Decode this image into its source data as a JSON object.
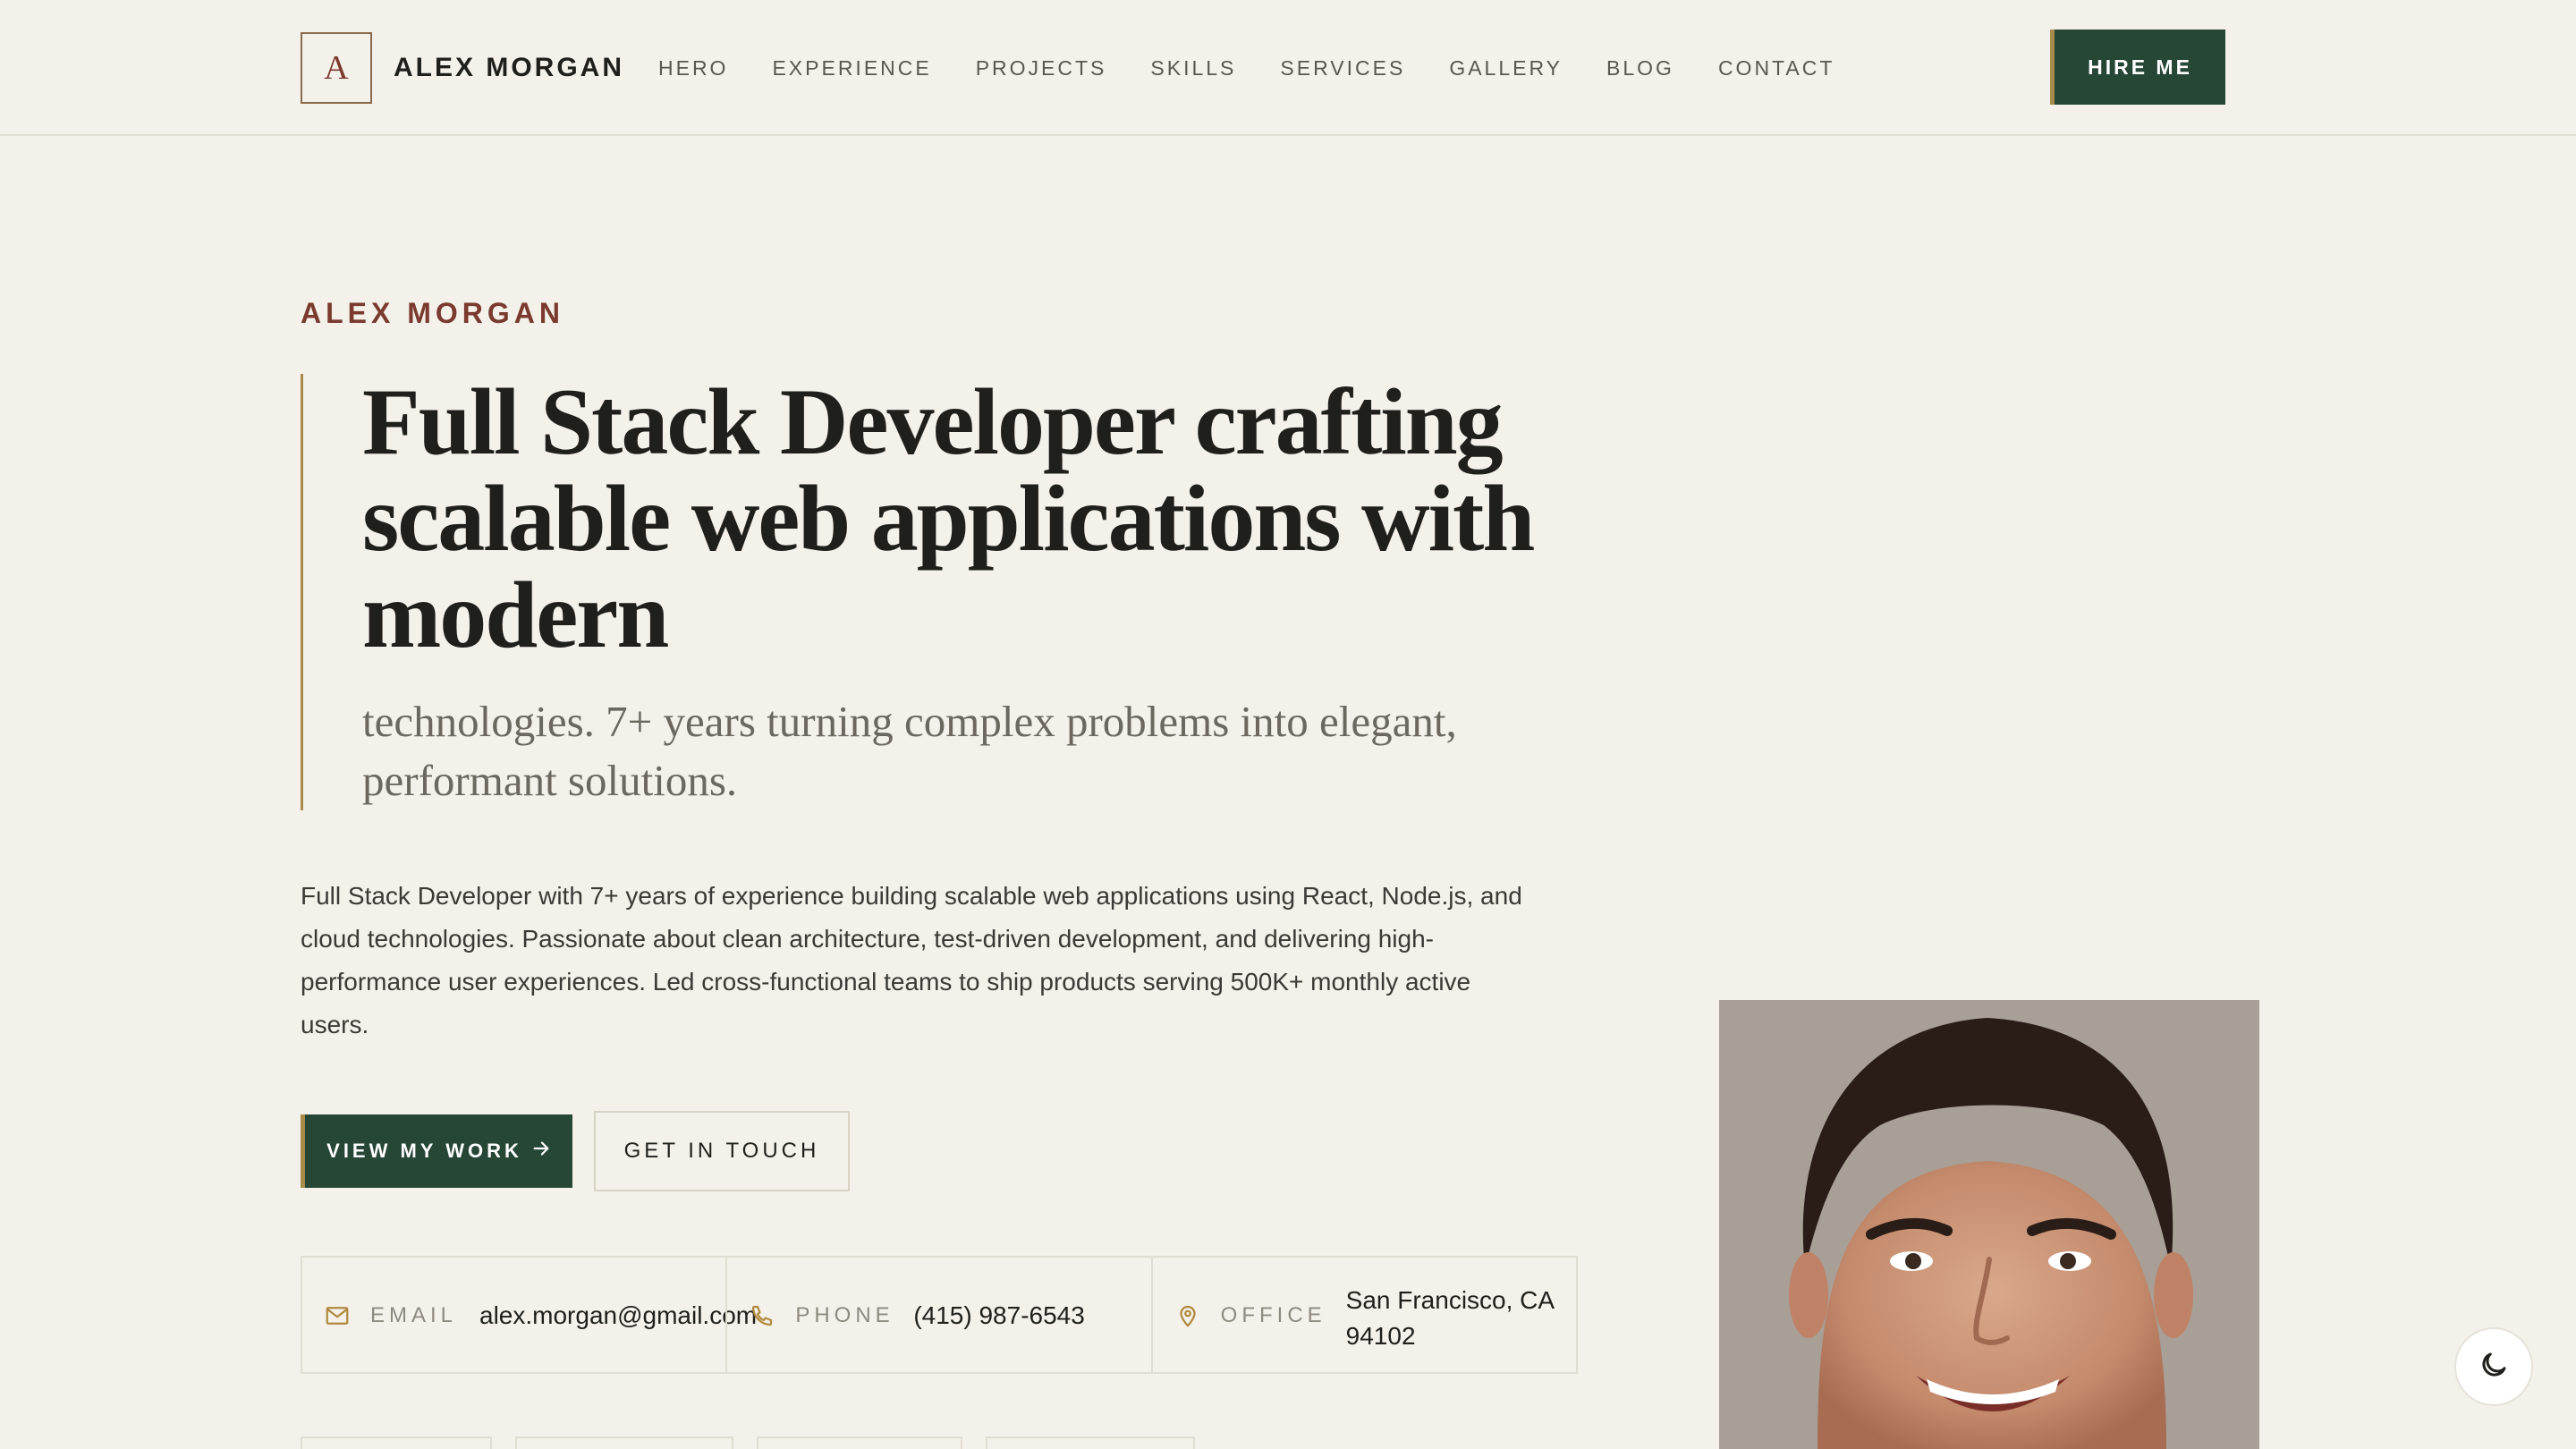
{
  "nav": {
    "logo_letter": "A",
    "brand_name": "ALEX MORGAN",
    "links": [
      "HERO",
      "EXPERIENCE",
      "PROJECTS",
      "SKILLS",
      "SERVICES",
      "GALLERY",
      "BLOG",
      "CONTACT"
    ],
    "hire_label": "HIRE ME"
  },
  "hero": {
    "eyebrow": "ALEX MORGAN",
    "headline_lines": [
      "Full Stack Developer crafting",
      "scalable web applications with",
      "modern"
    ],
    "subhead_lines": [
      "technologies. 7+ years turning complex problems into elegant,",
      "performant solutions."
    ],
    "bio": "Full Stack Developer with 7+ years of experience building scalable web applications using React, Node.js, and cloud technologies. Passionate about clean architecture, test-driven development, and delivering high-performance user experiences. Led cross-functional teams to ship products serving 500K+ monthly active users.",
    "primary_cta": "VIEW MY WORK",
    "secondary_cta": "GET IN TOUCH"
  },
  "contact": {
    "email_label": "EMAIL",
    "email_value": "alex.morgan@gmail.com",
    "phone_label": "PHONE",
    "phone_value": "(415) 987-6543",
    "office_label": "OFFICE",
    "office_value": "San Francisco, CA 94102"
  },
  "icons": {
    "email": "mail-icon",
    "phone": "phone-icon",
    "office": "map-pin-icon",
    "cta_arrow": "arrow-right-icon",
    "theme": "moon-icon"
  },
  "colors": {
    "background": "#f4f1ea",
    "accent_green": "#264636",
    "accent_gold": "#a88a4a",
    "accent_maroon": "#7a3a2e"
  }
}
